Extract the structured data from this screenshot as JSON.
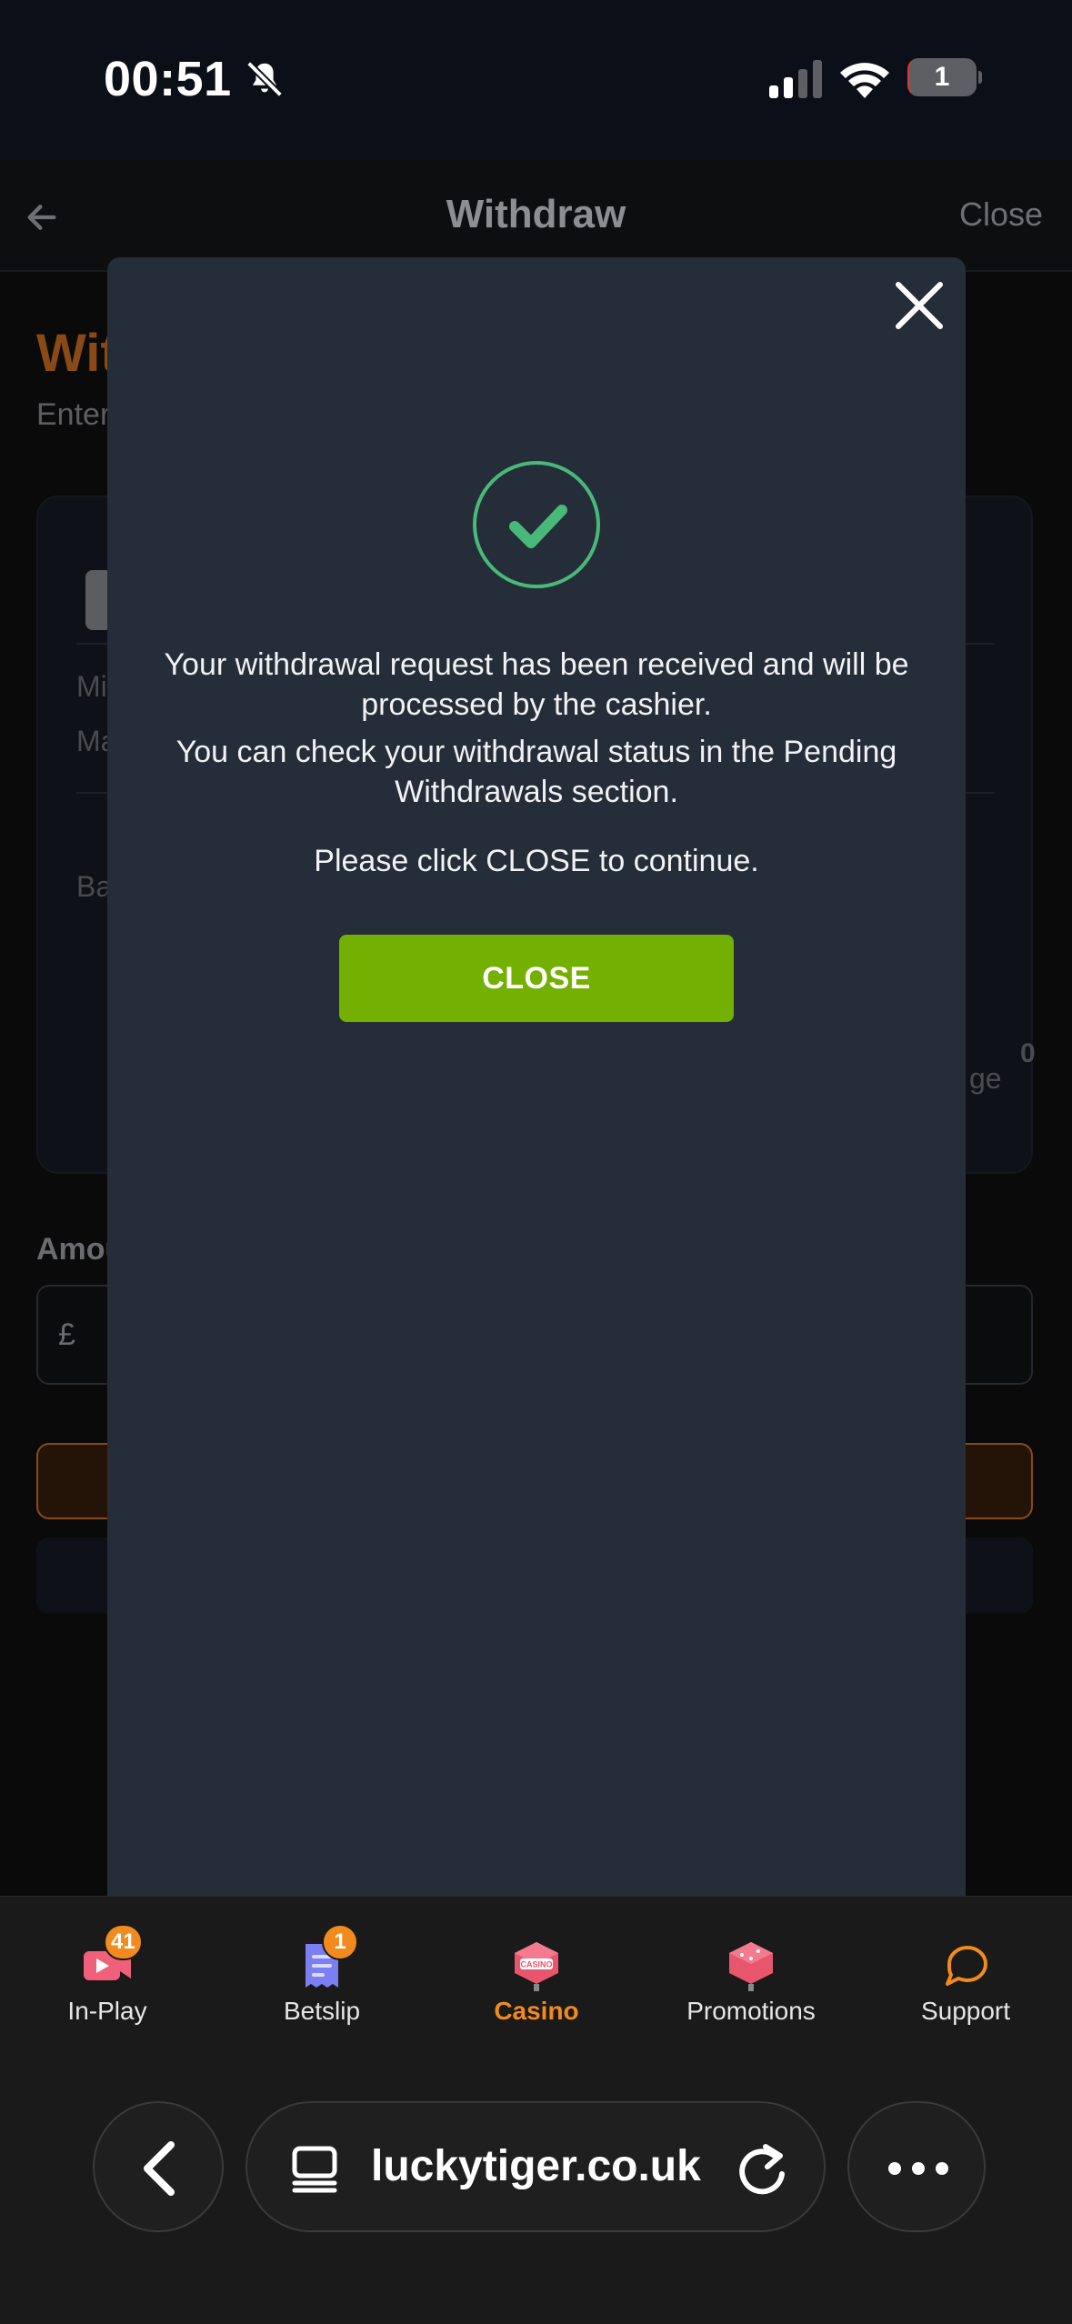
{
  "status_bar": {
    "time": "00:51",
    "battery_level": "1"
  },
  "header": {
    "title": "Withdraw",
    "close_label": "Close"
  },
  "background": {
    "heading_fragment": "Wit",
    "sub_fragment": "Enter",
    "card_fragments": [
      "Mi",
      "Ma",
      "Ba",
      "ge",
      "0"
    ],
    "amount_label_fragment": "Amou",
    "currency_symbol": "£"
  },
  "modal": {
    "message_1": "Your withdrawal request has been received and will be processed by the cashier.",
    "message_2": "You can check your withdrawal status in the Pending Withdrawals section.",
    "message_3": "Please click CLOSE to continue.",
    "close_button": "CLOSE",
    "success_color": "#48b978",
    "button_color": "#73b000"
  },
  "bottom_nav": {
    "items": [
      {
        "label": "In-Play",
        "icon": "play-video-icon",
        "badge": "41"
      },
      {
        "label": "Betslip",
        "icon": "receipt-icon",
        "badge": "1"
      },
      {
        "label": "Casino",
        "icon": "casino-chip-icon",
        "active": true
      },
      {
        "label": "Promotions",
        "icon": "gift-box-icon"
      },
      {
        "label": "Support",
        "icon": "chat-bubble-icon"
      }
    ],
    "accent_color": "#f28a1e"
  },
  "browser": {
    "url": "luckytiger.co.uk"
  }
}
